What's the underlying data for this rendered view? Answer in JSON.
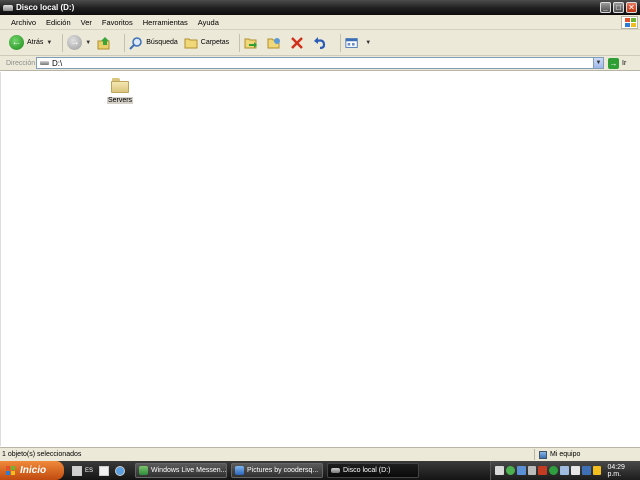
{
  "window": {
    "title": "Disco local (D:)"
  },
  "menu": [
    "Archivo",
    "Edición",
    "Ver",
    "Favoritos",
    "Herramientas",
    "Ayuda"
  ],
  "toolbar": {
    "back_label": "Atrás",
    "search_label": "Búsqueda",
    "folders_label": "Carpetas"
  },
  "address": {
    "label": "Dirección",
    "value": "D:\\",
    "go_label": "Ir"
  },
  "content": {
    "items": [
      {
        "name": "Servers",
        "type": "folder",
        "selected": true
      }
    ]
  },
  "status": {
    "text": "1 objeto(s) seleccionados",
    "zone": "Mi equipo"
  },
  "taskbar": {
    "start_label": "Inicio",
    "quick_launch_text": "ES",
    "tasks": [
      {
        "label": "Windows Live Messen...",
        "icon": "messenger-icon"
      },
      {
        "label": "Pictures by coodersq...",
        "icon": "ie-icon"
      },
      {
        "label": "Disco local (D:)",
        "icon": "drive-icon"
      }
    ],
    "clock": "04:29 p.m."
  },
  "colors": {
    "title_bar": "#1f1f1f",
    "face": "#ece9d8",
    "start_button": "#e0661e"
  }
}
